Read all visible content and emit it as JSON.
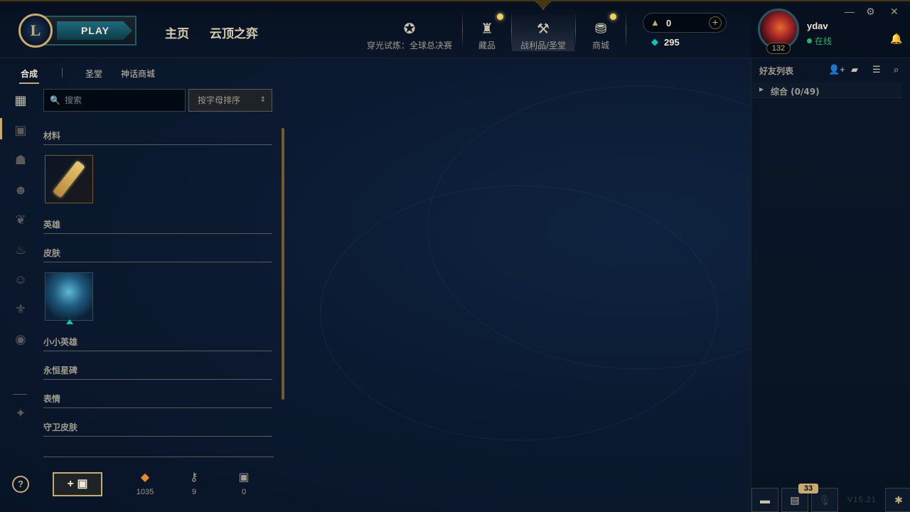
{
  "app": {
    "logo_letter": "L",
    "play_label": "PLAY"
  },
  "nav": {
    "home": "主页",
    "tft": "云顶之弈"
  },
  "topicons": [
    {
      "name": "worlds",
      "glyph": "✪",
      "label": "穿光试炼：全球总决赛"
    },
    {
      "name": "collection",
      "glyph": "♜",
      "label": "藏品"
    },
    {
      "name": "loot",
      "glyph": "⚒",
      "label": "战利品/圣堂"
    },
    {
      "name": "store",
      "glyph": "⛃",
      "label": "商城"
    }
  ],
  "wallet": {
    "blue_essence": "0",
    "riot_points": "295",
    "be_icon": "▲",
    "rp_icon": "◆",
    "add_symbol": "+"
  },
  "profile": {
    "username": "ydav",
    "status": "在线",
    "level": "132"
  },
  "window": {
    "minimize": "—",
    "settings": "⚙",
    "close": "✕"
  },
  "loot": {
    "tabs": [
      "合成",
      "圣堂",
      "神话商城"
    ],
    "search_placeholder": "搜索",
    "sort_label": "按字母排序",
    "categories": [
      "材料",
      "英雄",
      "皮肤",
      "小小英雄",
      "永恒星碑",
      "表情",
      "守卫皮肤"
    ]
  },
  "counters": [
    {
      "name": "orange-essence",
      "glyph": "◆",
      "value": "1035",
      "color": "#e8892a"
    },
    {
      "name": "key-fragment",
      "glyph": "⚷",
      "value": "9",
      "color": "#a09b8c"
    },
    {
      "name": "chest",
      "glyph": "▣",
      "value": "0",
      "color": "#a09b8c"
    }
  ],
  "bottom": {
    "help": "?",
    "add_chest": "+ ▣"
  },
  "social": {
    "title": "好友列表",
    "group_label": "综合 (0/49)",
    "chat_badge": "33",
    "version": "V15.21"
  }
}
